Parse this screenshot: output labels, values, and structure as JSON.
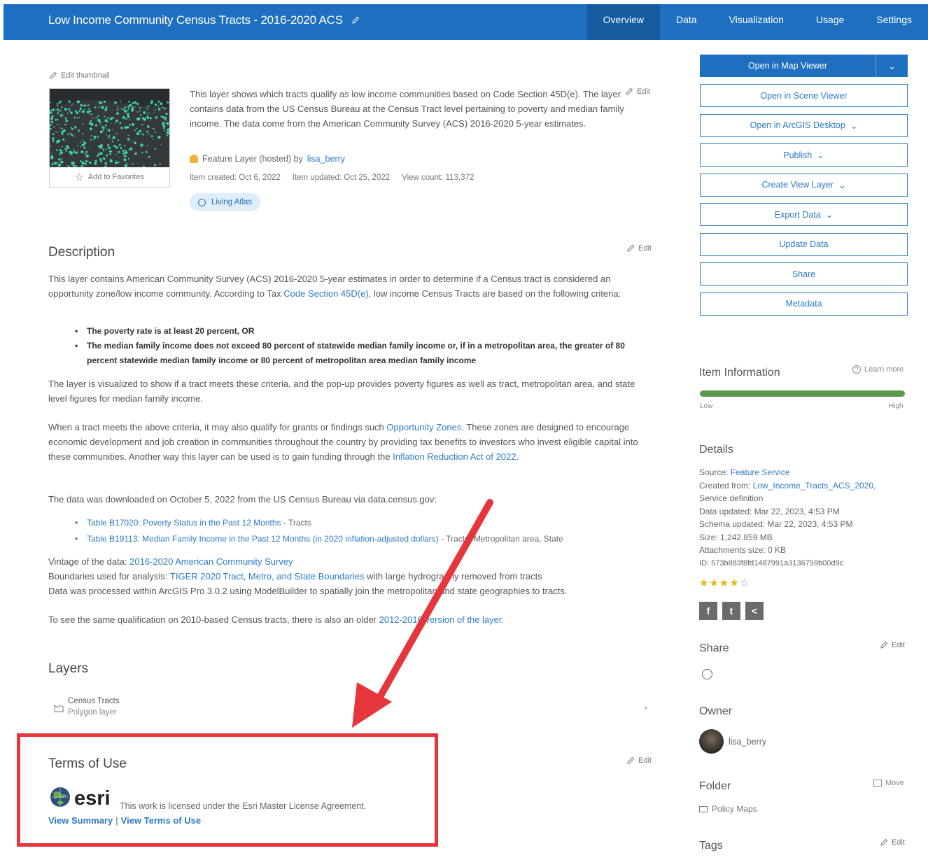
{
  "header": {
    "title": "Low Income Community Census Tracts - 2016-2020 ACS",
    "tabs": [
      "Overview",
      "Data",
      "Visualization",
      "Usage",
      "Settings"
    ]
  },
  "thumbnail": {
    "edit_label": "Edit thumbnail",
    "favorites_label": "Add to Favorites"
  },
  "summary": {
    "text": "This layer shows which tracts qualify as low income communities based on Code Section 45D(e). The layer contains data from the US Census Bureau at the Census Tract level pertaining to poverty and median family income. The data come from the American Community Survey (ACS) 2016-2020 5-year estimates.",
    "edit_label": "Edit",
    "type_prefix": "Feature Layer (hosted) by",
    "owner": "lisa_berry",
    "item_created": "Item created: Oct 6, 2022",
    "item_updated": "Item updated: Oct 25, 2022",
    "view_count": "View count: 113,372",
    "badge": "Living Atlas"
  },
  "description": {
    "heading": "Description",
    "edit_label": "Edit",
    "p1_a": "This layer contains American Community Survey (ACS) 2016-2020 5-year estimates in order to determine if a Census tract is considered an opportunity zone/low income community. According to Tax ",
    "p1_link": "Code Section 45D(e)",
    "p1_b": ", low income Census Tracts are based on the following criteria:",
    "criteria": [
      "The poverty rate is at least 20 percent, OR",
      "The median family income does not exceed 80 percent of statewide median family income or, if in a metropolitan area, the greater of 80 percent statewide median family income or 80 percent of metropolitan area median family income"
    ],
    "p2": "The layer is visualized to show if a tract meets these criteria, and the pop-up provides poverty figures as well as tract, metropolitan area, and state level figures for median family income.",
    "p3_a": "When a tract meets the above criteria, it may also qualify for grants or findings such ",
    "p3_link1": "Opportunity Zones",
    "p3_b": ". These zones are designed to encourage economic development and job creation in communities throughout the country by providing tax benefits to investors who invest eligible capital into these communities. Another way this layer can be used is to gain funding through the ",
    "p3_link2": "Inflation Reduction Act of 2022",
    "p3_c": ".",
    "p4": "The data was downloaded on October 5, 2022 from the US Census Bureau via data.census.gov:",
    "tables": [
      {
        "link": "Table B17020: Poverty Status in the Past 12 Months",
        "rest": " - Tracts"
      },
      {
        "link": "Table B19113: Median Family Income in the Past 12 Months (in 2020 inflation-adjusted dollars)",
        "rest": " - Tracts, Metropolitan area, State"
      }
    ],
    "vintage_label": "Vintage of the data: ",
    "vintage_link": "2016-2020 American Community Survey",
    "boundaries_label": "Boundaries used for analysis: ",
    "boundaries_link": "TIGER 2020 Tract, Metro, and State Boundaries",
    "boundaries_rest": " with large hydrography removed from tracts",
    "processed": "Data was processed within ArcGIS Pro 3.0.2 using ModelBuilder to spatially join the metropolitan and state geographies to tracts.",
    "older_a": "To see the same qualification on 2010-based Census tracts, there is also an older ",
    "older_link": "2012-2016 version of the layer."
  },
  "layers": {
    "heading": "Layers",
    "items": [
      {
        "name": "Census Tracts",
        "type": "Polygon layer"
      }
    ]
  },
  "terms": {
    "heading": "Terms of Use",
    "edit_label": "Edit",
    "logo_text": "esri",
    "license": "This work is licensed under the Esri Master License Agreement.",
    "view_summary": "View Summary",
    "separator": "|",
    "view_terms": "View Terms of Use"
  },
  "actions": {
    "open_map_viewer": "Open in Map Viewer",
    "buttons": [
      {
        "label": "Open in Scene Viewer",
        "dropdown": false
      },
      {
        "label": "Open in ArcGIS Desktop",
        "dropdown": true
      },
      {
        "label": "Publish",
        "dropdown": true
      },
      {
        "label": "Create View Layer",
        "dropdown": true
      },
      {
        "label": "Export Data",
        "dropdown": true
      },
      {
        "label": "Update Data",
        "dropdown": false
      },
      {
        "label": "Share",
        "dropdown": false
      },
      {
        "label": "Metadata",
        "dropdown": false
      }
    ]
  },
  "item_info": {
    "heading": "Item Information",
    "learn_more": "Learn more",
    "low": "Low",
    "high": "High",
    "level": 1.0,
    "color": "#5a9a4c"
  },
  "details": {
    "heading": "Details",
    "source_label": "Source: ",
    "source_link": "Feature Service",
    "created_from_label": "Created from: ",
    "created_from_link": "Low_Income_Tracts_ACS_2020,",
    "service_definition": "Service definition",
    "data_updated": "Data updated: Mar 22, 2023, 4:53 PM",
    "schema_updated": "Schema updated: Mar 22, 2023, 4:53 PM",
    "size": "Size: 1,242.859 MB",
    "attachments": "Attachments size: 0 KB",
    "id": "ID: 573b883f8fd1487991a3136759b00d9c",
    "rating": 4,
    "rating_max": 5
  },
  "share": {
    "heading": "Share",
    "edit_label": "Edit"
  },
  "owner": {
    "heading": "Owner",
    "name": "lisa_berry"
  },
  "folder": {
    "heading": "Folder",
    "move_label": "Move",
    "name": "Policy Maps"
  },
  "tags": {
    "heading": "Tags",
    "edit_label": "Edit"
  },
  "colors": {
    "header": "#1e6fbf",
    "link": "#2e7bc4",
    "highlight_box": "#e5363c",
    "thumbnail_points": "#3fd1b0"
  }
}
